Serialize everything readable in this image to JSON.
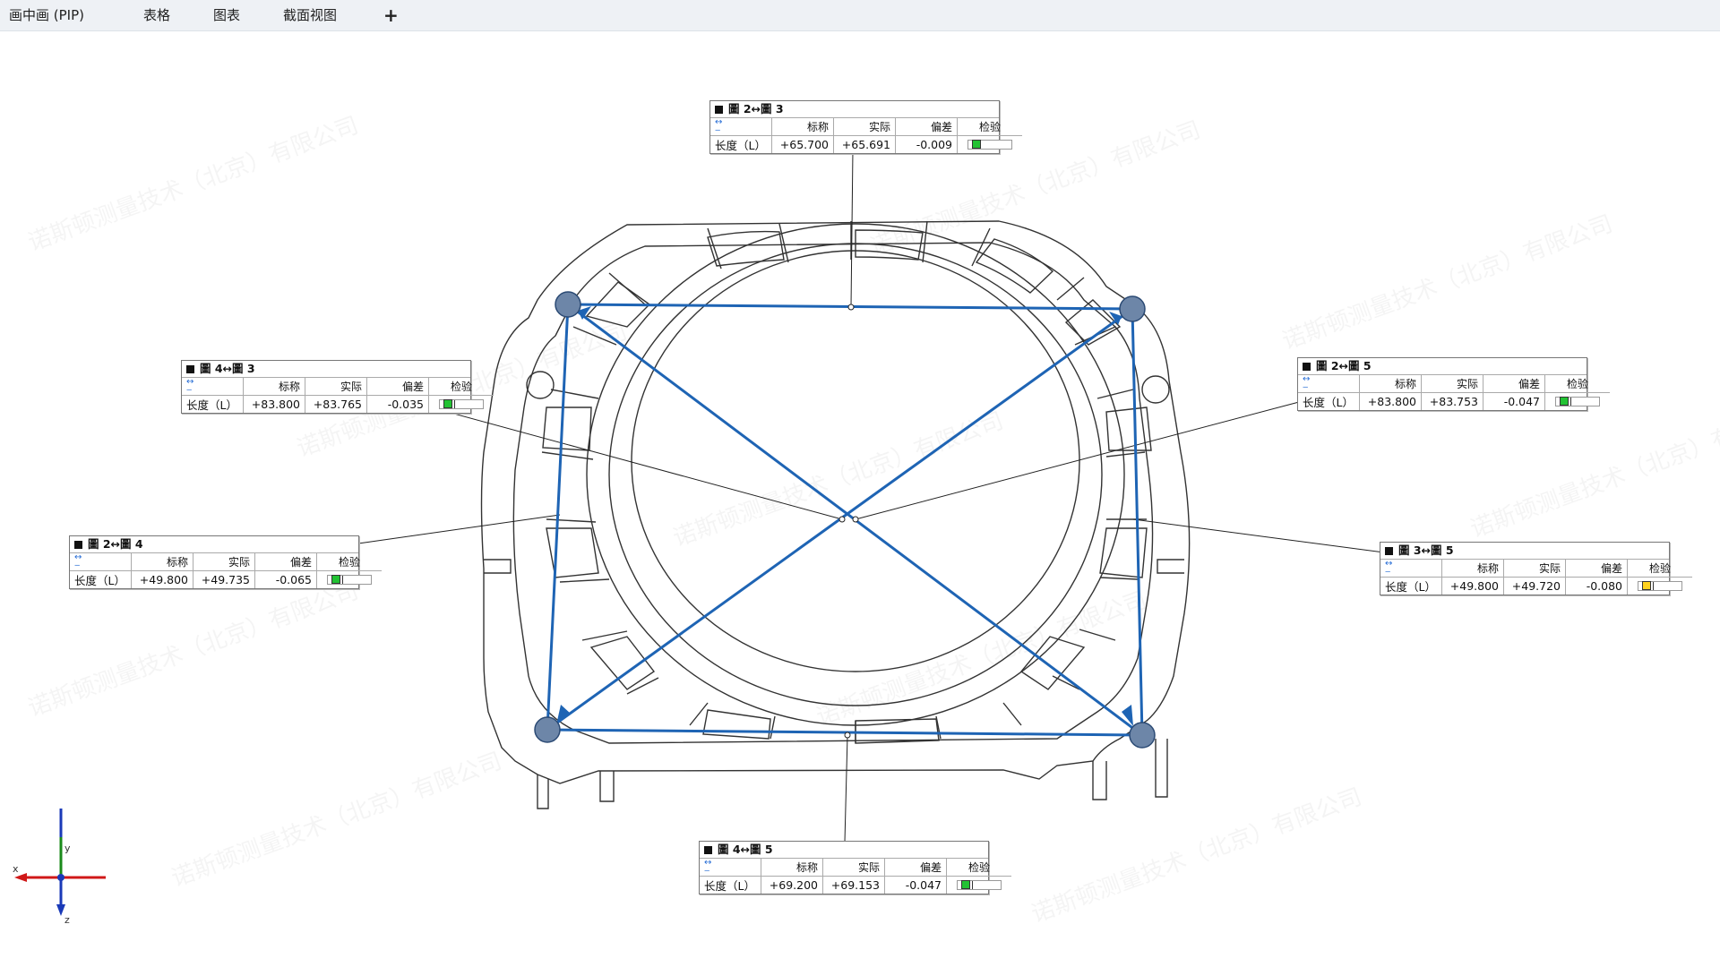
{
  "tabs": [
    {
      "label": "画中画 (PIP)"
    },
    {
      "label": "表格"
    },
    {
      "label": "图表"
    },
    {
      "label": "截面视图"
    }
  ],
  "add_tab_label": "+",
  "watermark_text": "诺斯顿测量技术（北京）有限公司",
  "colors": {
    "accent_line": "#1e64b4",
    "pass": "#22c233",
    "warn": "#ffd21e",
    "part_outline": "#333333",
    "axis_x": "#d01818",
    "axis_y": "#1a8a1a",
    "axis_z": "#1d3fb8"
  },
  "callouts": [
    {
      "id": "c23",
      "title": "圖 2↔圖 3",
      "headers": [
        "标称",
        "实际",
        "偏差",
        "检验"
      ],
      "row_label": "长度（L）",
      "nominal": "+65.700",
      "actual": "+65.691",
      "deviation": "-0.009",
      "status": "pass"
    },
    {
      "id": "c43",
      "title": "圖 4↔圖 3",
      "headers": [
        "标称",
        "实际",
        "偏差",
        "检验"
      ],
      "row_label": "长度（L）",
      "nominal": "+83.800",
      "actual": "+83.765",
      "deviation": "-0.035",
      "status": "pass"
    },
    {
      "id": "c25",
      "title": "圖 2↔圖 5",
      "headers": [
        "标称",
        "实际",
        "偏差",
        "检验"
      ],
      "row_label": "长度（L）",
      "nominal": "+83.800",
      "actual": "+83.753",
      "deviation": "-0.047",
      "status": "pass"
    },
    {
      "id": "c24",
      "title": "圖 2↔圖 4",
      "headers": [
        "标称",
        "实际",
        "偏差",
        "检验"
      ],
      "row_label": "长度（L）",
      "nominal": "+49.800",
      "actual": "+49.735",
      "deviation": "-0.065",
      "status": "pass"
    },
    {
      "id": "c35",
      "title": "圖 3↔圖 5",
      "headers": [
        "标称",
        "实际",
        "偏差",
        "检验"
      ],
      "row_label": "长度（L）",
      "nominal": "+49.800",
      "actual": "+49.720",
      "deviation": "-0.080",
      "status": "warn"
    },
    {
      "id": "c45",
      "title": "圖 4↔圖 5",
      "headers": [
        "标称",
        "实际",
        "偏差",
        "检验"
      ],
      "row_label": "长度（L）",
      "nominal": "+69.200",
      "actual": "+69.153",
      "deviation": "-0.047",
      "status": "pass"
    }
  ],
  "axis": {
    "x_label": "x",
    "y_label": "y",
    "z_label": "z"
  }
}
